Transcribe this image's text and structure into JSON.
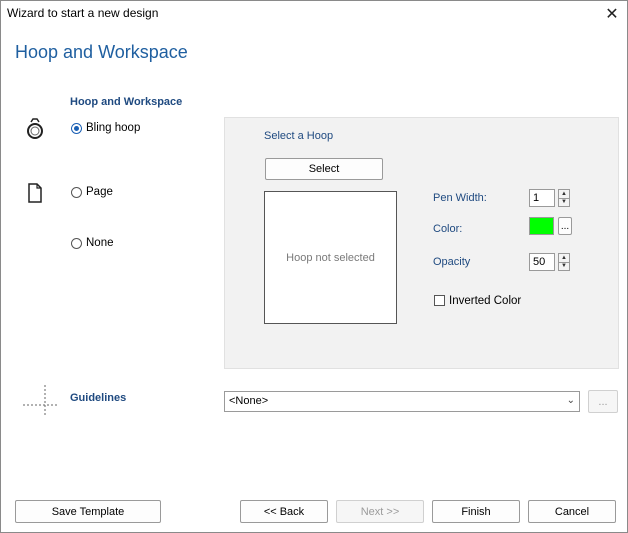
{
  "window": {
    "title": "Wizard to start a new design",
    "close_glyph": "✕"
  },
  "page": {
    "heading": "Hoop and Workspace"
  },
  "workspace_section": {
    "label": "Hoop and Workspace",
    "options": [
      {
        "label": "Bling hoop",
        "checked": true,
        "icon": "ring-icon"
      },
      {
        "label": "Page",
        "checked": false,
        "icon": "document-icon"
      },
      {
        "label": "None",
        "checked": false,
        "icon": ""
      }
    ]
  },
  "hoop_panel": {
    "title": "Select a Hoop",
    "select_button": "Select",
    "preview_text": "Hoop not selected",
    "pen_width_label": "Pen Width:",
    "pen_width_value": "1",
    "color_label": "Color:",
    "color_value": "#00ff00",
    "color_more_button": "...",
    "opacity_label": "Opacity",
    "opacity_value": "50",
    "inverted_color_label": "Inverted Color",
    "inverted_color_checked": false
  },
  "guidelines": {
    "label": "Guidelines",
    "selected": "<None>",
    "more_button": "..."
  },
  "footer": {
    "save_template": "Save Template",
    "back": "<< Back",
    "next": "Next >>",
    "finish": "Finish",
    "cancel": "Cancel"
  }
}
